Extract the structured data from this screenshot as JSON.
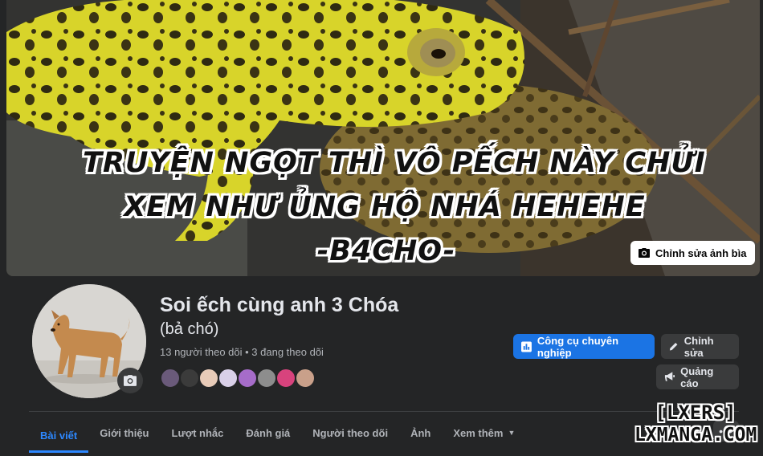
{
  "cover": {
    "caption_lines": [
      "TRUYỆN NGỌT THÌ VÔ PẾCH NÀY CHỬI",
      "XEM NHƯ ỦNG HỘ NHÁ HEHEHE",
      "-B4CHO-"
    ],
    "edit_cover_label": "Chỉnh sửa ảnh bìa"
  },
  "profile": {
    "name": "Soi ếch cùng anh 3 Chóa",
    "alternate_name": "(bả chó)",
    "follow_stats": "13 người theo dõi • 3 đang theo dõi",
    "follower_avatar_colors": [
      "#6a5a7a",
      "#3b3b3b",
      "#e8cbb8",
      "#d9d0e8",
      "#a66cc9",
      "#8d8d8d",
      "#d8437d",
      "#c9a08a"
    ]
  },
  "actions": {
    "professional_tools_label": "Công cụ chuyên nghiệp",
    "edit_label": "Chỉnh sửa",
    "ads_label": "Quảng cáo"
  },
  "tabs": [
    {
      "label": "Bài viết",
      "active": true
    },
    {
      "label": "Giới thiệu",
      "active": false
    },
    {
      "label": "Lượt nhắc",
      "active": false
    },
    {
      "label": "Đánh giá",
      "active": false
    },
    {
      "label": "Người theo dõi",
      "active": false
    },
    {
      "label": "Ảnh",
      "active": false
    },
    {
      "label": "Xem thêm",
      "active": false
    }
  ],
  "watermark": {
    "line1": "[LXERS]",
    "line2": "LXMANGA.COM"
  },
  "colors": {
    "accent": "#1b74e4",
    "active_tab": "#2d88ff",
    "background": "#242526",
    "button_secondary": "#3a3b3c"
  }
}
